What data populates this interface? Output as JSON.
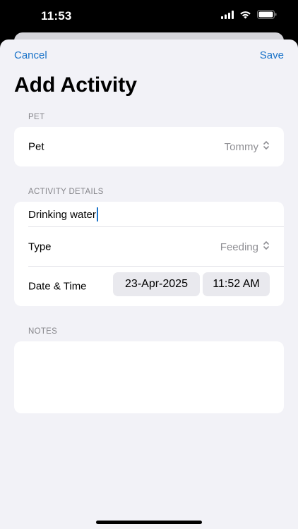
{
  "status_bar": {
    "time": "11:53"
  },
  "nav": {
    "cancel_label": "Cancel",
    "save_label": "Save"
  },
  "title": "Add Activity",
  "pet_section": {
    "header": "PET",
    "row_label": "Pet",
    "value": "Tommy"
  },
  "details_section": {
    "header": "ACTIVITY DETAILS",
    "name_value": "Drinking water",
    "type_label": "Type",
    "type_value": "Feeding",
    "datetime_label": "Date & Time",
    "date_value": "23-Apr-2025",
    "time_value": "11:52 AM"
  },
  "notes_section": {
    "header": "NOTES",
    "value": ""
  },
  "colors": {
    "accent": "#1a73c9",
    "background": "#f2f2f7",
    "secondary_text": "#8e8e93"
  },
  "icons": [
    "signal-icon",
    "wifi-icon",
    "battery-icon",
    "chevron-up-down-icon"
  ]
}
